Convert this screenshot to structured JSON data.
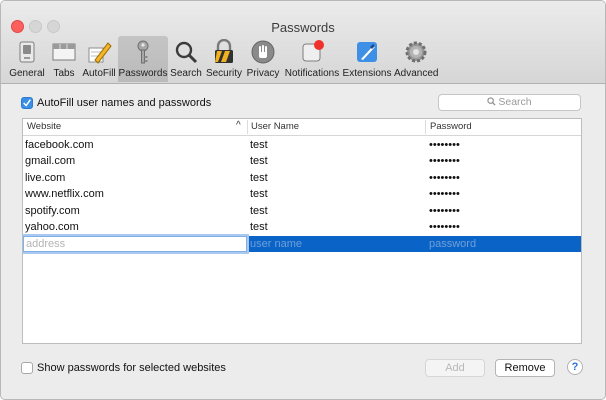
{
  "window": {
    "title": "Passwords"
  },
  "toolbar": {
    "items": [
      {
        "label": "General",
        "icon": "general-switch-icon"
      },
      {
        "label": "Tabs",
        "icon": "tabs-icon"
      },
      {
        "label": "AutoFill",
        "icon": "autofill-pencil-icon"
      },
      {
        "label": "Passwords",
        "icon": "key-icon",
        "selected": true
      },
      {
        "label": "Search",
        "icon": "magnifier-icon"
      },
      {
        "label": "Security",
        "icon": "padlock-icon"
      },
      {
        "label": "Privacy",
        "icon": "hand-icon"
      },
      {
        "label": "Notifications",
        "icon": "notification-badge-icon"
      },
      {
        "label": "Extensions",
        "icon": "puzzle-icon"
      },
      {
        "label": "Advanced",
        "icon": "gear-icon"
      }
    ]
  },
  "autofill": {
    "label": "AutoFill user names and passwords",
    "checked": true
  },
  "search": {
    "placeholder": "Search"
  },
  "table": {
    "columns": [
      "Website",
      "User Name",
      "Password"
    ],
    "sort_indicator": "^",
    "rows": [
      {
        "website": "facebook.com",
        "user": "test",
        "password": "••••••••"
      },
      {
        "website": "gmail.com",
        "user": "test",
        "password": "••••••••"
      },
      {
        "website": "live.com",
        "user": "test",
        "password": "••••••••"
      },
      {
        "website": "www.netflix.com",
        "user": "test",
        "password": "••••••••"
      },
      {
        "website": "spotify.com",
        "user": "test",
        "password": "••••••••"
      },
      {
        "website": "yahoo.com",
        "user": "test",
        "password": "••••••••"
      }
    ],
    "new_row": {
      "website_placeholder": "address",
      "user_placeholder": "user name",
      "password_placeholder": "password"
    }
  },
  "show_passwords": {
    "label": "Show passwords for selected websites",
    "checked": false
  },
  "buttons": {
    "add": "Add",
    "remove": "Remove",
    "help": "?"
  },
  "colors": {
    "selection": "#0a64c8",
    "accent": "#3a8ee6",
    "close": "#fc605c"
  }
}
